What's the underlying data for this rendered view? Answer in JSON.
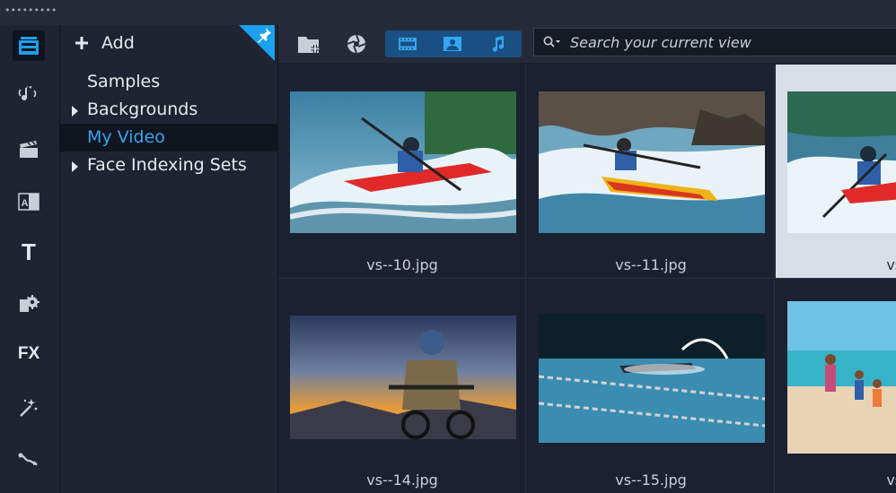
{
  "library": {
    "add_label": "Add",
    "tree": [
      {
        "label": "Samples",
        "expandable": false,
        "selected": false
      },
      {
        "label": "Backgrounds",
        "expandable": true,
        "selected": false
      },
      {
        "label": "My Video",
        "expandable": false,
        "selected": true
      },
      {
        "label": "Face Indexing Sets",
        "expandable": true,
        "selected": false
      }
    ]
  },
  "rail": {
    "text_label": "T",
    "fx_label": "FX",
    "ab_label": "AB"
  },
  "search": {
    "placeholder": "Search your current view"
  },
  "media": [
    {
      "name": "vs--10.jpg",
      "subject": "kayak-whitewater"
    },
    {
      "name": "vs--11.jpg",
      "subject": "kayak-rapids"
    },
    {
      "name": "vs--",
      "subject": "kayak-closeup",
      "selected": true
    },
    {
      "name": "vs--14.jpg",
      "subject": "mountain-biker-sunset"
    },
    {
      "name": "vs--15.jpg",
      "subject": "swimmer-pool"
    },
    {
      "name": "vs--",
      "subject": "family-beach"
    }
  ],
  "colors": {
    "accent": "#1aa1ef",
    "selected_text": "#35a6ee",
    "background": "#1b2130"
  }
}
